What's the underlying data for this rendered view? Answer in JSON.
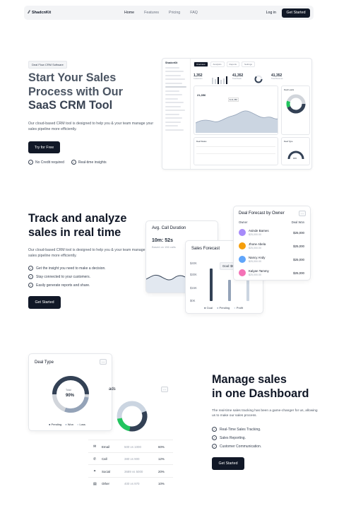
{
  "nav": {
    "brand": "ShadcnKit",
    "menu": [
      "Home",
      "Features",
      "Pricing",
      "FAQ"
    ],
    "login": "Log in",
    "cta": "Get Started"
  },
  "hero": {
    "badge": "Deal Flow CRM Software",
    "title_line1": "Start Your Sales",
    "title_line2": "Process with Our",
    "title_line3": "SaaS CRM Tool",
    "description": "Our cloud-based CRM tool is designed to help you & your team manage your sales pipeline more efficiently.",
    "cta": "Try for Free",
    "checks": [
      "No Credit required",
      "Real-time insights"
    ]
  },
  "dashboard": {
    "brand": "ShadcnKit",
    "tabs": [
      "Overview",
      "Analytics",
      "Reports",
      "Settings"
    ],
    "stats": [
      {
        "value": "1,352",
        "label": "Customers"
      },
      {
        "value": "41,352",
        "label": "Total Deals"
      },
      {
        "value": "41,352",
        "label": "Total Revenue"
      }
    ],
    "chart_value": "21,356",
    "chart_tooltip": "$ 21,356",
    "table_title": "Deal Status",
    "donut_title": "Deal Leads",
    "gauge_title": "Deal Type",
    "gauge_value": "90%"
  },
  "section2": {
    "title": "Track and analyze sales in real time",
    "description": "Our cloud-based CRM tool is designed to help you & your team manage your sales pipeline more efficiently.",
    "points": [
      "Get the insight you need to make a decision.",
      "Stay connected to your customers.",
      "Easily generate reports and share."
    ],
    "cta": "Get Started",
    "call_card": {
      "title": "Avg. Call Duration",
      "value": "10m: 52s",
      "sub": "Based on 156 calls"
    },
    "forecast_card": {
      "title": "Sales Forecast",
      "y_ticks": [
        "$40K",
        "$30K",
        "$15K",
        "$0K"
      ],
      "tooltip": "Goal: $6",
      "legend": [
        "Goal",
        "Pending",
        "Profit"
      ],
      "bar_colors": [
        "#334155",
        "#94a3b8",
        "#cbd5e1"
      ]
    },
    "owner_card": {
      "title": "Deal Forecast by Owner",
      "col_owner": "Owner",
      "col_deal": "Deal Won",
      "rows": [
        {
          "name": "Asinde Barnes",
          "sub": "$25,000.00",
          "value": "$25,000"
        },
        {
          "name": "Jhone Abela",
          "sub": "$25,000.00",
          "value": "$25,000"
        },
        {
          "name": "Nancy Andy",
          "sub": "$25,000.00",
          "value": "$25,000"
        },
        {
          "name": "Kalyan Tammy",
          "sub": "$25,000.00",
          "value": "$25,000"
        }
      ]
    }
  },
  "section3": {
    "title_line1": "Manage sales",
    "title_line2": "in one Dashboard",
    "description": "The real-time sales tracking has been a game-changer for us, allowing us to make our sales process.",
    "points": [
      "Real-Time Sales Tracking.",
      "Sales Reporting.",
      "Customer Communication."
    ],
    "cta": "Get Started",
    "deal_type_card": {
      "title": "Deal Type",
      "center_label": "Total",
      "center_value": "90%",
      "legend": [
        "Pending",
        "Won",
        "Loss"
      ]
    },
    "leads_card": {
      "title": "ads",
      "rows": [
        {
          "channel": "Email",
          "ratio": "500 vs 1000",
          "pct": "60%"
        },
        {
          "channel": "Call",
          "ratio": "380 vs 900",
          "pct": "12%"
        },
        {
          "channel": "Social",
          "ratio": "3689 vs 5000",
          "pct": "20%"
        },
        {
          "channel": "Other",
          "ratio": "400 vs 970",
          "pct": "10%"
        }
      ]
    }
  }
}
